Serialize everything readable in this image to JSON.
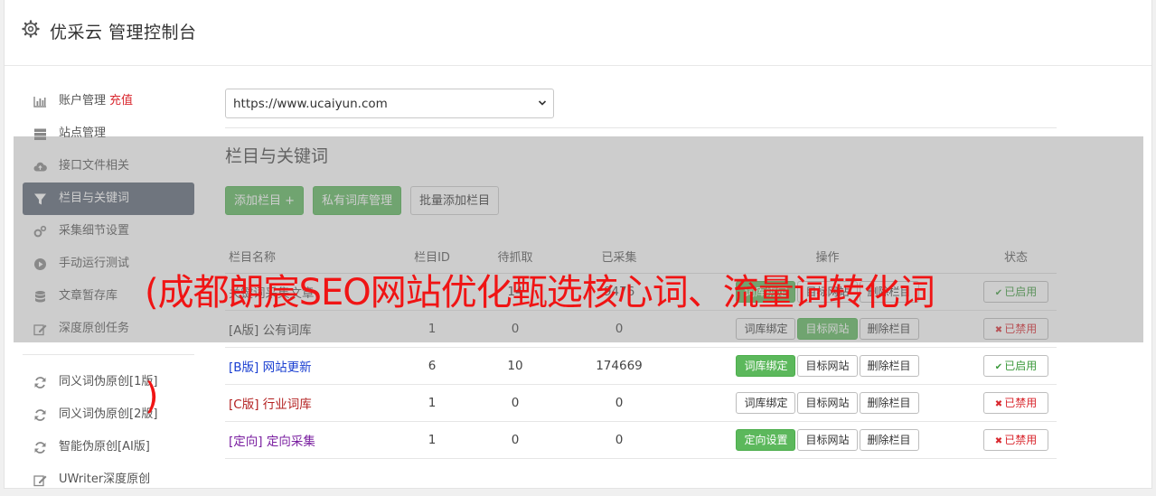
{
  "header": {
    "title": "优采云 管理控制台"
  },
  "sidebar": {
    "items": [
      {
        "label": "账户管理",
        "extra": "充值",
        "icon": "bar-chart-icon"
      },
      {
        "label": "站点管理",
        "icon": "server-icon"
      },
      {
        "label": "接口文件相关",
        "icon": "cloud-upload-icon"
      },
      {
        "label": "栏目与关键词",
        "icon": "filter-icon",
        "active": true
      },
      {
        "label": "采集细节设置",
        "icon": "gears-icon"
      },
      {
        "label": "手动运行测试",
        "icon": "play-circle-icon"
      },
      {
        "label": "文章暂存库",
        "icon": "database-icon"
      },
      {
        "label": "深度原创任务",
        "icon": "edit-icon"
      }
    ],
    "items2": [
      {
        "label": "同义词伪原创[1版]",
        "icon": "refresh-icon"
      },
      {
        "label": "同义词伪原创[2版]",
        "icon": "refresh-icon"
      },
      {
        "label": "智能伪原创[AI版]",
        "icon": "refresh-icon"
      },
      {
        "label": "UWriter深度原创",
        "icon": "edit-icon"
      }
    ]
  },
  "main": {
    "site_select": "https://www.ucaiyun.com",
    "section_title": "栏目与关键词",
    "buttons": {
      "add_column": "添加栏目 +",
      "private_lib": "私有词库管理",
      "batch_add": "批量添加栏目"
    },
    "table": {
      "headers": [
        "栏目名称",
        "栏目ID",
        "待抓取",
        "已采集",
        "操作",
        "状态"
      ],
      "rows": [
        {
          "tag": "",
          "name": "关键词采集文章",
          "id": "",
          "pending": "14",
          "collected": "9476",
          "op1": "词库绑定",
          "op2": "目标网站",
          "op3": "删除栏目",
          "status": "已启用"
        },
        {
          "tag": "[A版]",
          "name": "公有词库",
          "id": "1",
          "pending": "0",
          "collected": "0",
          "op1": "词库绑定",
          "op2": "目标网站",
          "op3": "删除栏目",
          "status": "已禁用"
        },
        {
          "tag": "[B版]",
          "name": "网站更新",
          "id": "6",
          "pending": "10",
          "collected": "174669",
          "op1": "词库绑定",
          "op2": "目标网站",
          "op3": "删除栏目",
          "status": "已启用"
        },
        {
          "tag": "[C版]",
          "name": "行业词库",
          "id": "1",
          "pending": "0",
          "collected": "0",
          "op1": "词库绑定",
          "op2": "目标网站",
          "op3": "删除栏目",
          "status": "已禁用"
        },
        {
          "tag": "[定向]",
          "name": "定向采集",
          "id": "1",
          "pending": "0",
          "collected": "0",
          "op1": "定向设置",
          "op2": "目标网站",
          "op3": "删除栏目",
          "status": "已禁用"
        }
      ]
    }
  },
  "watermark": {
    "line1": "(成都朗宸SEO网站优化甄选核心词、流量词转化词",
    "line2": ")"
  },
  "colors": {
    "green": "#5cb85c",
    "active_nav": "#5b6474",
    "red": "#d9272e",
    "blue_link": "#1a3fd1",
    "red_link": "#b32020",
    "purple_link": "#7a1fa0"
  }
}
